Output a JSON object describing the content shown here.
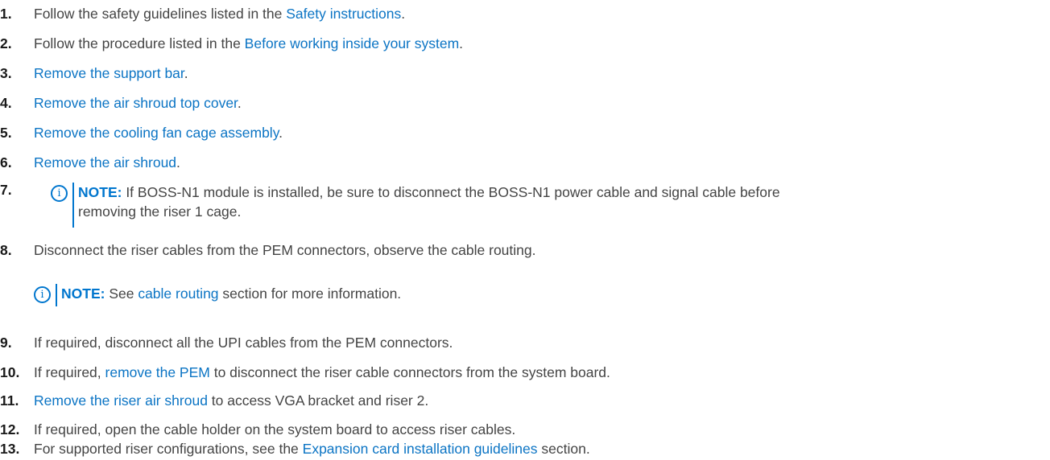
{
  "steps": [
    {
      "num": "1.",
      "pre": "Follow the safety guidelines listed in the ",
      "link": "Safety instructions",
      "post": "."
    },
    {
      "num": "2.",
      "pre": "Follow the procedure listed in the ",
      "link": "Before working inside your system",
      "post": "."
    },
    {
      "num": "3.",
      "pre": "",
      "link": "Remove the support bar",
      "post": "."
    },
    {
      "num": "4.",
      "pre": "",
      "link": "Remove the air shroud top cover",
      "post": "."
    },
    {
      "num": "5.",
      "pre": "",
      "link": "Remove the cooling fan cage assembly",
      "post": "."
    },
    {
      "num": "6.",
      "pre": "",
      "link": "Remove the air shroud",
      "post": "."
    },
    {
      "num": "7."
    },
    {
      "num": "8.",
      "pre": "Disconnect the riser cables from the PEM connectors, observe the cable routing.",
      "link": "",
      "post": ""
    },
    {
      "num": "9.",
      "pre": "If required, disconnect all the UPI cables from the PEM connectors.",
      "link": "",
      "post": ""
    },
    {
      "num": "10.",
      "pre": "If required, ",
      "link": "remove the PEM",
      "post": " to disconnect the riser cable connectors from the system board."
    },
    {
      "num": "11.",
      "pre": "",
      "link": "Remove the riser air shroud",
      "post": " to access VGA bracket and riser 2."
    },
    {
      "num": "12.",
      "pre": "If required, open the cable holder on the system board to access riser cables.",
      "link": "",
      "post": ""
    },
    {
      "num": "13.",
      "pre": "For supported riser configurations, see the ",
      "link": "Expansion card installation guidelines",
      "post": " section."
    }
  ],
  "note7": {
    "label": "NOTE:",
    "line1": " If BOSS-N1 module is installed, be sure to disconnect the BOSS-N1 power cable and signal cable before",
    "line2": "removing the riser 1 cage."
  },
  "note8": {
    "label": "NOTE:",
    "pre": " See ",
    "link": "cable routing",
    "post": " section for more information."
  },
  "note_icon": "info-icon",
  "colors": {
    "link": "#0b74c4",
    "note_accent": "#0076ce",
    "text": "#444444",
    "number": "#1a1a1a"
  }
}
